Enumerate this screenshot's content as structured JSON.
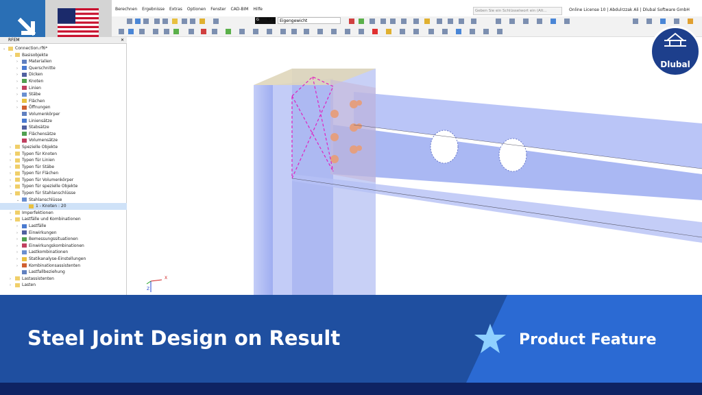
{
  "menu": [
    "Berechnen",
    "Ergebnisse",
    "Extras",
    "Optionen",
    "Fenster",
    "CAD-BIM",
    "Hilfe"
  ],
  "search": {
    "placeholder": "Geben Sie ein Schlüsselwort ein (Alt..."
  },
  "license": "Online License 10 | Abdulrzzak Ali | Dlubal Software GmbH",
  "loadcase": {
    "code": "G",
    "id": "LF1",
    "name": "Eigengewicht"
  },
  "navigator": {
    "tab": "RFEM",
    "items": [
      {
        "label": "Connection.rf6*",
        "level": 0,
        "exp": "v"
      },
      {
        "label": "Basisobjekte",
        "level": 1,
        "exp": "v"
      },
      {
        "label": "Materialien",
        "level": 2,
        "exp": ">"
      },
      {
        "label": "Querschnitte",
        "level": 2,
        "exp": ">"
      },
      {
        "label": "Dicken",
        "level": 2,
        "exp": ">"
      },
      {
        "label": "Knoten",
        "level": 2,
        "exp": ">"
      },
      {
        "label": "Linien",
        "level": 2,
        "exp": ">"
      },
      {
        "label": "Stäbe",
        "level": 2,
        "exp": ">"
      },
      {
        "label": "Flächen",
        "level": 2,
        "exp": ">"
      },
      {
        "label": "Öffnungen",
        "level": 2,
        "exp": ">"
      },
      {
        "label": "Volumenkörper",
        "level": 2,
        "exp": ""
      },
      {
        "label": "Liniensätze",
        "level": 2,
        "exp": ""
      },
      {
        "label": "Stabsätze",
        "level": 2,
        "exp": ""
      },
      {
        "label": "Flächensätze",
        "level": 2,
        "exp": ""
      },
      {
        "label": "Volumensätze",
        "level": 2,
        "exp": ""
      },
      {
        "label": "Spezielle Objekte",
        "level": 1,
        "exp": ">"
      },
      {
        "label": "Typen für Knoten",
        "level": 1,
        "exp": ">"
      },
      {
        "label": "Typen für Linien",
        "level": 1,
        "exp": ">"
      },
      {
        "label": "Typen für Stäbe",
        "level": 1,
        "exp": ">"
      },
      {
        "label": "Typen für Flächen",
        "level": 1,
        "exp": ">"
      },
      {
        "label": "Typen für Volumenkörper",
        "level": 1,
        "exp": ">"
      },
      {
        "label": "Typen für spezielle Objekte",
        "level": 1,
        "exp": ">"
      },
      {
        "label": "Typen für Stahlanschlüsse",
        "level": 1,
        "exp": "v"
      },
      {
        "label": "Stahlanschlüsse",
        "level": 2,
        "exp": "v"
      },
      {
        "label": "1 - Knoten : 20",
        "level": 3,
        "exp": "",
        "selected": true
      },
      {
        "label": "Imperfektionen",
        "level": 1,
        "exp": ">"
      },
      {
        "label": "Lastfälle und Kombinationen",
        "level": 1,
        "exp": "v"
      },
      {
        "label": "Lastfälle",
        "level": 2,
        "exp": ">"
      },
      {
        "label": "Einwirkungen",
        "level": 2,
        "exp": ">"
      },
      {
        "label": "Bemessungssituationen",
        "level": 2,
        "exp": ">"
      },
      {
        "label": "Einwirkungskombinationen",
        "level": 2,
        "exp": ">"
      },
      {
        "label": "Lastkombinationen",
        "level": 2,
        "exp": ">"
      },
      {
        "label": "Statikanalyse-Einstellungen",
        "level": 2,
        "exp": ">"
      },
      {
        "label": "Kombinationsassistenten",
        "level": 2,
        "exp": ">"
      },
      {
        "label": "Lastfallbeziehung",
        "level": 2,
        "exp": ""
      },
      {
        "label": "Lastassistenten",
        "level": 1,
        "exp": ">"
      },
      {
        "label": "Lasten",
        "level": 1,
        "exp": ">"
      }
    ]
  },
  "logo": "Dlubal",
  "axes": {
    "x": "X",
    "z": "Z"
  },
  "banner": {
    "title": "Steel Joint Design on Result",
    "feature": "Product Feature"
  },
  "colors": {
    "banner_dark": "#0e2363",
    "banner_mid": "#1f4fa0",
    "banner_light": "#2b6ad3",
    "member": "#9aaaf0",
    "plate": "#e6c9a0",
    "bolt": "#e49f80",
    "weld": "#e020c0"
  }
}
